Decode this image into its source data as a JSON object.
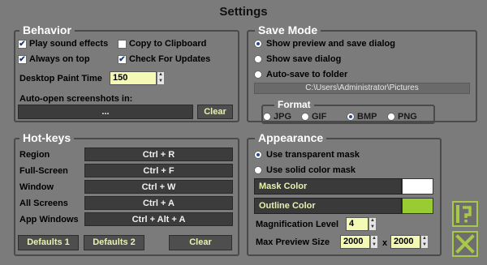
{
  "window": {
    "title": "Settings"
  },
  "behavior": {
    "legend": "Behavior",
    "play_sound": {
      "label": "Play sound effects",
      "checked": true
    },
    "copy_clipboard": {
      "label": "Copy to Clipboard",
      "checked": false
    },
    "always_on_top": {
      "label": "Always on top",
      "checked": true
    },
    "check_updates": {
      "label": "Check For Updates",
      "checked": true
    },
    "paint_time_label": "Desktop Paint Time",
    "paint_time_value": "150",
    "auto_open_label": "Auto-open screenshots in:",
    "auto_open_value": "...",
    "clear_label": "Clear"
  },
  "save_mode": {
    "legend": "Save Mode",
    "options": [
      "Show preview and save dialog",
      "Show save dialog",
      "Auto-save to folder"
    ],
    "selected": "Show preview and save dialog",
    "folder_path": "C:\\Users\\Administrator\\Pictures",
    "format": {
      "legend": "Format",
      "options": [
        "JPG",
        "GIF",
        "BMP",
        "PNG"
      ],
      "selected": "BMP"
    }
  },
  "hotkeys": {
    "legend": "Hot-keys",
    "rows": [
      {
        "label": "Region",
        "key": "Ctrl + R"
      },
      {
        "label": "Full-Screen",
        "key": "Ctrl + F"
      },
      {
        "label": "Window",
        "key": "Ctrl + W"
      },
      {
        "label": "All Screens",
        "key": "Ctrl + A"
      },
      {
        "label": "App Windows",
        "key": "Ctrl + Alt + A"
      }
    ],
    "defaults1_label": "Defaults 1",
    "defaults2_label": "Defaults 2",
    "clear_label": "Clear"
  },
  "appearance": {
    "legend": "Appearance",
    "options": [
      "Use transparent mask",
      "Use solid color mask"
    ],
    "selected": "Use transparent mask",
    "mask_color_label": "Mask Color",
    "mask_color": "#ffffff",
    "outline_color_label": "Outline Color",
    "outline_color": "#99cc33",
    "magnification_label": "Magnification Level",
    "magnification_value": "4",
    "max_preview_label": "Max Preview Size",
    "max_preview_w": "2000",
    "max_preview_x": "x",
    "max_preview_h": "2000"
  },
  "side_buttons": {
    "help_icon": "help-icon",
    "close_icon": "close-icon"
  }
}
